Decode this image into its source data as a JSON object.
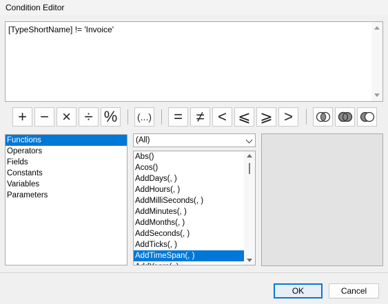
{
  "window": {
    "title": "Condition Editor"
  },
  "expression": {
    "text": "[TypeShortName] != 'Invoice'"
  },
  "toolbar": {
    "arith": [
      "+",
      "−",
      "×",
      "÷",
      "%"
    ],
    "paren": "(...)",
    "compare": [
      "=",
      "≠",
      "<",
      "⩽",
      "⩾",
      ">"
    ],
    "logic_icons": [
      "and-venn-icon",
      "or-venn-icon",
      "not-venn-icon"
    ]
  },
  "categories": {
    "items": [
      "Functions",
      "Operators",
      "Fields",
      "Constants",
      "Variables",
      "Parameters"
    ],
    "selected": "Functions"
  },
  "filter": {
    "value": "(All)"
  },
  "functions": {
    "items": [
      "Abs()",
      "Acos()",
      "AddDays(, )",
      "AddHours(, )",
      "AddMilliSeconds(, )",
      "AddMinutes(, )",
      "AddMonths(, )",
      "AddSeconds(, )",
      "AddTicks(, )",
      "AddTimeSpan(, )",
      "AddYears(, )"
    ],
    "selected": "AddTimeSpan(, )"
  },
  "buttons": {
    "ok": "OK",
    "cancel": "Cancel"
  },
  "colors": {
    "selection": "#0078d7",
    "background": "#f0f0f0"
  }
}
